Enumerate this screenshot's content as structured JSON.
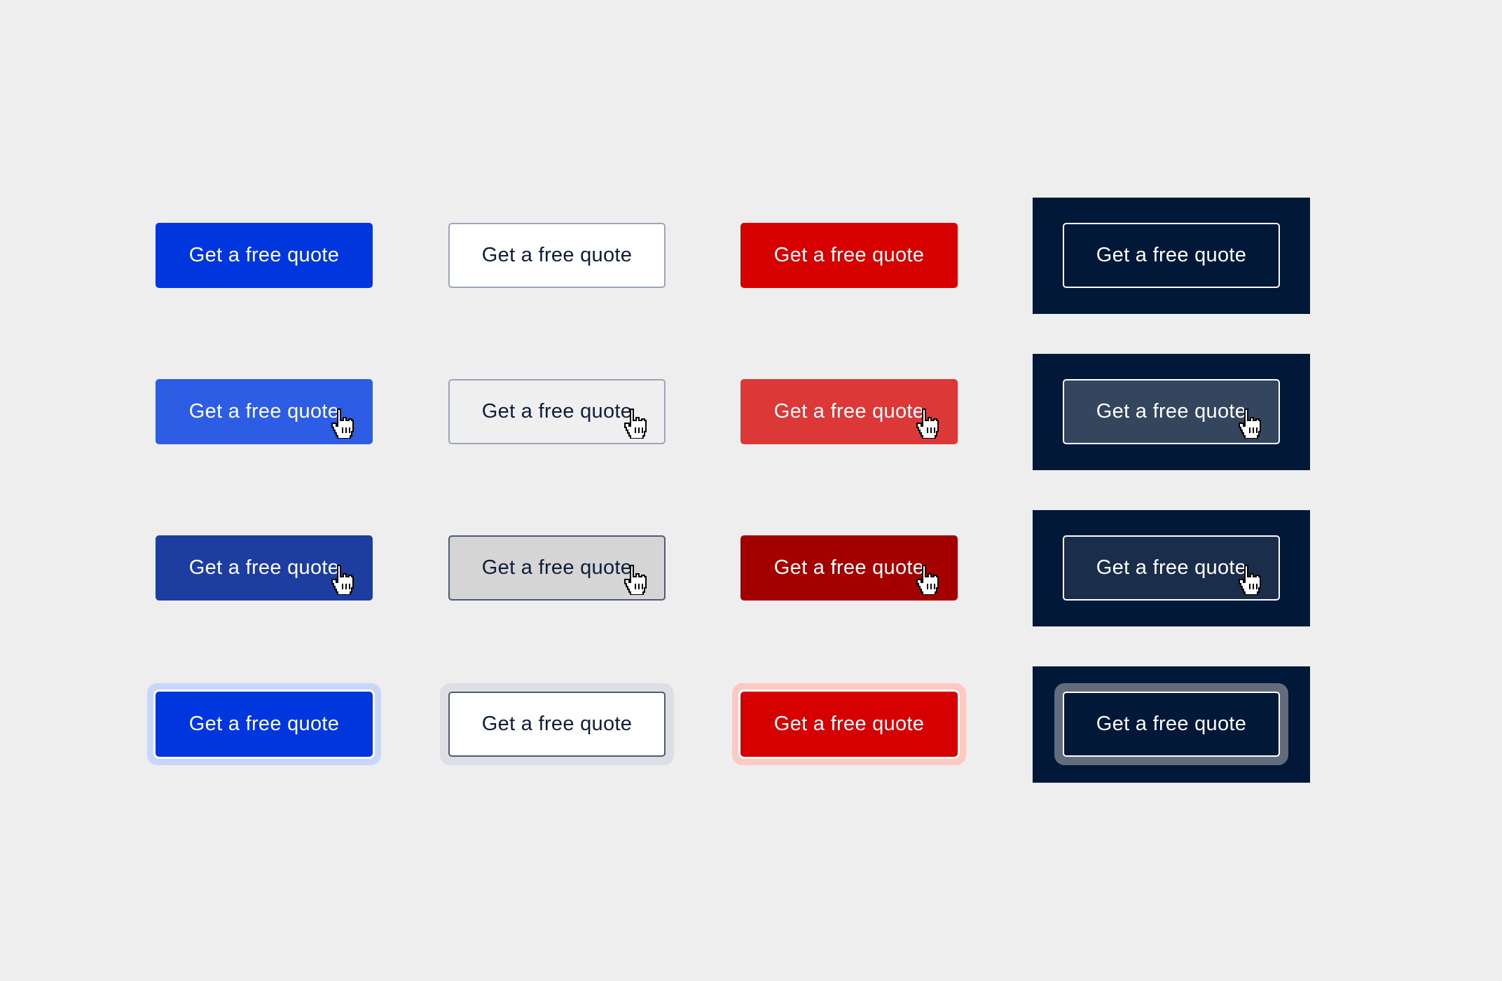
{
  "buttons": {
    "primary": {
      "default": "Get a free quote",
      "hover": "Get a free quote",
      "active": "Get a free quote",
      "focus": "Get a free quote"
    },
    "secondary": {
      "default": "Get a free quote",
      "hover": "Get a free quote",
      "active": "Get a free quote",
      "focus": "Get a free quote"
    },
    "danger": {
      "default": "Get a free quote",
      "hover": "Get a free quote",
      "active": "Get a free quote",
      "focus": "Get a free quote"
    },
    "inverse": {
      "default": "Get a free quote",
      "hover": "Get a free quote",
      "active": "Get a free quote",
      "focus": "Get a free quote"
    }
  },
  "colors": {
    "background": "#efeeee",
    "primary": "#0036de",
    "primary_hover": "#2d5de4",
    "primary_active": "#1d3da0",
    "primary_focus_ring": "#c9d6fb",
    "secondary_border": "#9aa6b8",
    "secondary_active": "#d5d5d5",
    "secondary_text": "#0d1e3a",
    "danger": "#d60000",
    "danger_hover": "#dd3838",
    "danger_active": "#a50000",
    "danger_focus_ring": "#fec9c1",
    "inverse_panel": "#011839",
    "inverse_hover": "#33465e",
    "inverse_active": "#1a2e4b",
    "inverse_focus_ring": "#626c7c"
  },
  "icons": {
    "cursor": "pointer-hand-cursor-icon"
  }
}
